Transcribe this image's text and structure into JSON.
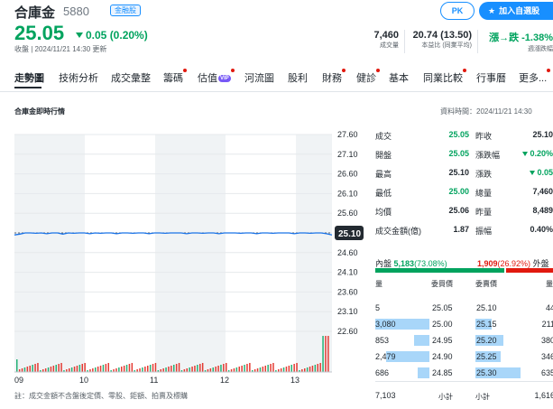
{
  "header": {
    "name": "合庫金",
    "code": "5880",
    "tag": "金融股",
    "price": "25.05",
    "change": "0.05 (0.20%)",
    "status": "收盤 | 2024/11/21 14:30 更新",
    "pk_label": "PK",
    "watch_label": "加入自選股",
    "stats": [
      {
        "value": "7,460",
        "label": "成交量"
      },
      {
        "value": "20.74 (13.50)",
        "label": "本益比 (同業平均)"
      },
      {
        "value": "漲→跌 (-1.38%)",
        "label": "週漲跌幅"
      }
    ],
    "stat3_prefix": "漲→跌",
    "stat3_pct": "-1.38%"
  },
  "tabs": [
    {
      "label": "走勢圖",
      "active": true,
      "dot": false
    },
    {
      "label": "技術分析",
      "dot": false
    },
    {
      "label": "成交彙整",
      "dot": false
    },
    {
      "label": "籌碼",
      "dot": true
    },
    {
      "label": "估值",
      "dot": true,
      "vip": "VIP"
    },
    {
      "label": "河流圖",
      "dot": false
    },
    {
      "label": "股利",
      "dot": false
    },
    {
      "label": "財務",
      "dot": true
    },
    {
      "label": "健診",
      "dot": true
    },
    {
      "label": "基本",
      "dot": false
    },
    {
      "label": "同業比較",
      "dot": true
    },
    {
      "label": "行事曆",
      "dot": false
    },
    {
      "label": "更多...",
      "dot": true
    }
  ],
  "section": {
    "title": "合庫金即時行情",
    "data_time": "資料時間：2024/11/21 14:30"
  },
  "chart_data": {
    "type": "line",
    "title": "",
    "y_ticks": [
      "27.60",
      "27.10",
      "26.60",
      "26.10",
      "25.60",
      "25.10",
      "24.60",
      "24.10",
      "23.60",
      "23.10",
      "22.60"
    ],
    "ylim": [
      22.6,
      27.6
    ],
    "x_ticks": [
      "09",
      "10",
      "11",
      "12",
      "13"
    ],
    "reference_price": 25.1,
    "last_price_label": "25.10",
    "series": [
      {
        "values": [
          25.05,
          25.07,
          25.1,
          25.1,
          25.09,
          25.1,
          25.08,
          25.1,
          25.1,
          25.07,
          25.1,
          25.09,
          25.1,
          25.1,
          25.08,
          25.1,
          25.09,
          25.1,
          25.1,
          25.08,
          25.1,
          25.1,
          25.09,
          25.1,
          25.1,
          25.08,
          25.1,
          25.1,
          25.09,
          25.1,
          25.1,
          25.1,
          25.08,
          25.1,
          25.1,
          25.09,
          25.1,
          25.1,
          25.08,
          25.1,
          25.1,
          25.1,
          25.09,
          25.1,
          25.1,
          25.08,
          25.1,
          25.1,
          25.09,
          25.1,
          25.1,
          25.1,
          25.08,
          25.1,
          25.1,
          25.09,
          25.1,
          25.1,
          25.08,
          25.05
        ]
      }
    ]
  },
  "quote": {
    "rows": [
      {
        "l1": "成交",
        "v1": "25.05",
        "v1c": "green",
        "l2": "昨收",
        "v2": "25.10",
        "v2c": ""
      },
      {
        "l1": "開盤",
        "v1": "25.05",
        "v1c": "green",
        "l2": "漲跌幅",
        "v2": "0.20%",
        "v2c": "green",
        "tri": true
      },
      {
        "l1": "最高",
        "v1": "25.10",
        "v1c": "",
        "l2": "漲跌",
        "v2": "0.05",
        "v2c": "green",
        "tri": true
      },
      {
        "l1": "最低",
        "v1": "25.00",
        "v1c": "green",
        "l2": "總量",
        "v2": "7,460",
        "v2c": ""
      },
      {
        "l1": "均價",
        "v1": "25.06",
        "v1c": "",
        "l2": "昨量",
        "v2": "8,489",
        "v2c": ""
      },
      {
        "l1": "成交金額(億)",
        "v1": "1.87",
        "v1c": "",
        "l2": "振幅",
        "v2": "0.40%",
        "v2c": ""
      }
    ]
  },
  "inout": {
    "inner_label": "內盤",
    "inner_value": "5,183",
    "inner_pct": "(73.08%)",
    "inner_ratio": 0.7308,
    "outer_value": "1,909",
    "outer_pct": "(26.92%)",
    "outer_label": "外盤"
  },
  "orderbook": {
    "head_qty": "量",
    "head_bid": "委買價",
    "head_ask": "委賣價",
    "bids": [
      {
        "qty": "5",
        "price": "25.05",
        "ratio": 0.0
      },
      {
        "qty": "3,080",
        "price": "25.00",
        "ratio": 1.0
      },
      {
        "qty": "853",
        "price": "24.95",
        "ratio": 0.28
      },
      {
        "qty": "2,479",
        "price": "24.90",
        "ratio": 0.8
      },
      {
        "qty": "686",
        "price": "24.85",
        "ratio": 0.22
      }
    ],
    "asks": [
      {
        "price": "25.10",
        "qty": "44",
        "ratio": 0.0
      },
      {
        "price": "25.15",
        "qty": "211",
        "ratio": 0.35
      },
      {
        "price": "25.20",
        "qty": "380",
        "ratio": 0.62
      },
      {
        "price": "25.25",
        "qty": "346",
        "ratio": 0.56
      },
      {
        "price": "25.30",
        "qty": "635",
        "ratio": 1.0
      }
    ],
    "total_bid": "7,103",
    "sub_label_1": "小計",
    "sub_label_2": "小計",
    "total_ask": "1,616"
  },
  "footnote": "註：成交金額不含盤後定價、零股、鉅額、拍賣及標購",
  "colors": {
    "up": "#e1190f",
    "down": "#00a35e",
    "accent": "#188fff",
    "line": "#1a73e8"
  }
}
